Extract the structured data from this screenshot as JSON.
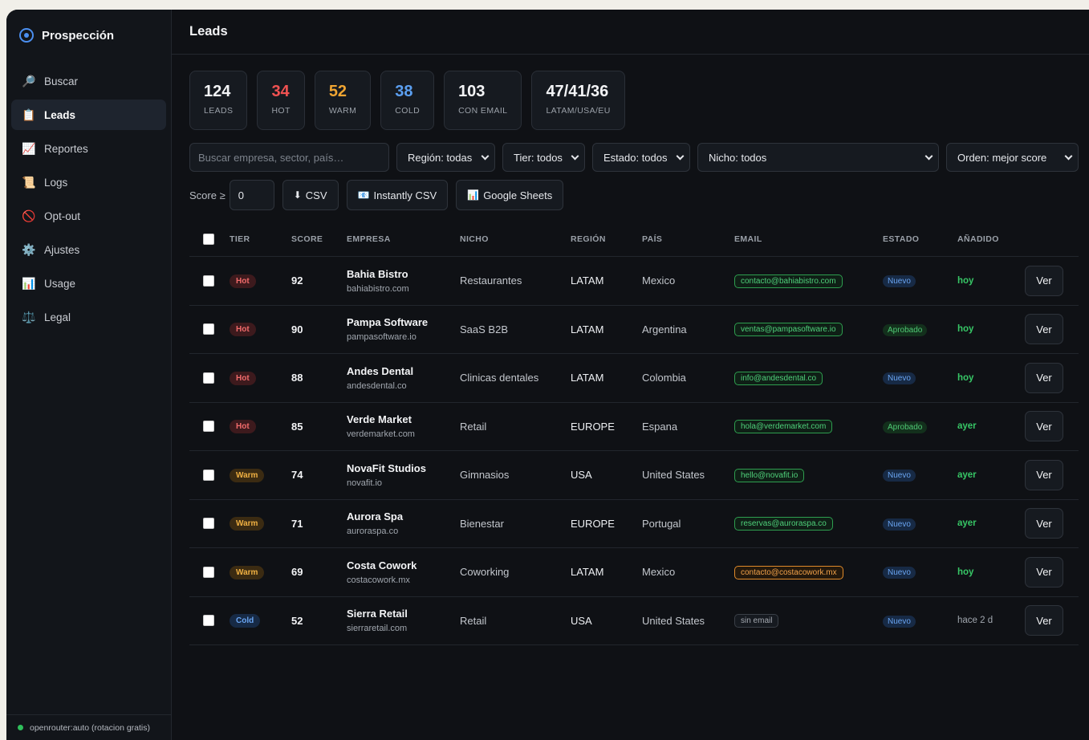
{
  "app": {
    "brand": "Prospección"
  },
  "sidebar": {
    "items": [
      {
        "label": "Buscar",
        "icon": "🔎",
        "name": "search-icon"
      },
      {
        "label": "Leads",
        "icon": "📋",
        "name": "clipboard-icon",
        "active": true
      },
      {
        "label": "Reportes",
        "icon": "📈",
        "name": "chart-icon"
      },
      {
        "label": "Logs",
        "icon": "📜",
        "name": "scroll-icon"
      },
      {
        "label": "Opt-out",
        "icon": "🚫",
        "name": "prohibited-icon"
      },
      {
        "label": "Ajustes",
        "icon": "⚙️",
        "name": "gear-icon"
      },
      {
        "label": "Usage",
        "icon": "📊",
        "name": "bar-chart-icon"
      },
      {
        "label": "Legal",
        "icon": "⚖️",
        "name": "scales-icon"
      }
    ],
    "footer": "openrouter:auto (rotacion gratis)"
  },
  "header": {
    "title": "Leads"
  },
  "stats": [
    {
      "value": "124",
      "label": "LEADS",
      "color": "#f3f4f6"
    },
    {
      "value": "34",
      "label": "HOT",
      "color": "#f05252"
    },
    {
      "value": "52",
      "label": "WARM",
      "color": "#f0a532"
    },
    {
      "value": "38",
      "label": "COLD",
      "color": "#5b9ff0"
    },
    {
      "value": "103",
      "label": "CON EMAIL",
      "color": "#f3f4f6"
    },
    {
      "value": "47/41/36",
      "label": "LATAM/USA/EU",
      "color": "#f3f4f6"
    }
  ],
  "filters": {
    "search_placeholder": "Buscar empresa, sector, país…",
    "region": "Región: todas",
    "tier": "Tier: todos",
    "estado": "Estado: todos",
    "nicho": "Nicho: todos",
    "orden": "Orden: mejor score"
  },
  "toolbar": {
    "score_label": "Score ≥",
    "score_value": "0",
    "csv": "CSV",
    "instantly": "Instantly CSV",
    "sheets": "Google Sheets"
  },
  "table": {
    "headers": [
      "TIER",
      "SCORE",
      "EMPRESA",
      "NICHO",
      "REGIÓN",
      "PAÍS",
      "EMAIL",
      "ESTADO",
      "AÑADIDO"
    ],
    "view_label": "Ver",
    "rows": [
      {
        "tier": "Hot",
        "score": "92",
        "name": "Bahia Bistro",
        "domain": "bahiabistro.com",
        "nicho": "Restaurantes",
        "region": "LATAM",
        "pais": "Mexico",
        "email": "contacto@bahiabistro.com",
        "email_style": "green",
        "estado": "Nuevo",
        "added": "hoy"
      },
      {
        "tier": "Hot",
        "score": "90",
        "name": "Pampa Software",
        "domain": "pampasoftware.io",
        "nicho": "SaaS B2B",
        "region": "LATAM",
        "pais": "Argentina",
        "email": "ventas@pampasoftware.io",
        "email_style": "green",
        "estado": "Aprobado",
        "added": "hoy"
      },
      {
        "tier": "Hot",
        "score": "88",
        "name": "Andes Dental",
        "domain": "andesdental.co",
        "nicho": "Clinicas dentales",
        "region": "LATAM",
        "pais": "Colombia",
        "email": "info@andesdental.co",
        "email_style": "green",
        "estado": "Nuevo",
        "added": "hoy"
      },
      {
        "tier": "Hot",
        "score": "85",
        "name": "Verde Market",
        "domain": "verdemarket.com",
        "nicho": "Retail",
        "region": "EUROPE",
        "pais": "Espana",
        "email": "hola@verdemarket.com",
        "email_style": "green",
        "estado": "Aprobado",
        "added": "ayer"
      },
      {
        "tier": "Warm",
        "score": "74",
        "name": "NovaFit Studios",
        "domain": "novafit.io",
        "nicho": "Gimnasios",
        "region": "USA",
        "pais": "United States",
        "email": "hello@novafit.io",
        "email_style": "green",
        "estado": "Nuevo",
        "added": "ayer"
      },
      {
        "tier": "Warm",
        "score": "71",
        "name": "Aurora Spa",
        "domain": "auroraspa.co",
        "nicho": "Bienestar",
        "region": "EUROPE",
        "pais": "Portugal",
        "email": "reservas@auroraspa.co",
        "email_style": "green",
        "estado": "Nuevo",
        "added": "ayer"
      },
      {
        "tier": "Warm",
        "score": "69",
        "name": "Costa Cowork",
        "domain": "costacowork.mx",
        "nicho": "Coworking",
        "region": "LATAM",
        "pais": "Mexico",
        "email": "contacto@costacowork.mx",
        "email_style": "orange",
        "estado": "Nuevo",
        "added": "hoy"
      },
      {
        "tier": "Cold",
        "score": "52",
        "name": "Sierra Retail",
        "domain": "sierraretail.com",
        "nicho": "Retail",
        "region": "USA",
        "pais": "United States",
        "email": "sin email",
        "email_style": "none",
        "estado": "Nuevo",
        "added": "hace 2 d"
      }
    ]
  }
}
